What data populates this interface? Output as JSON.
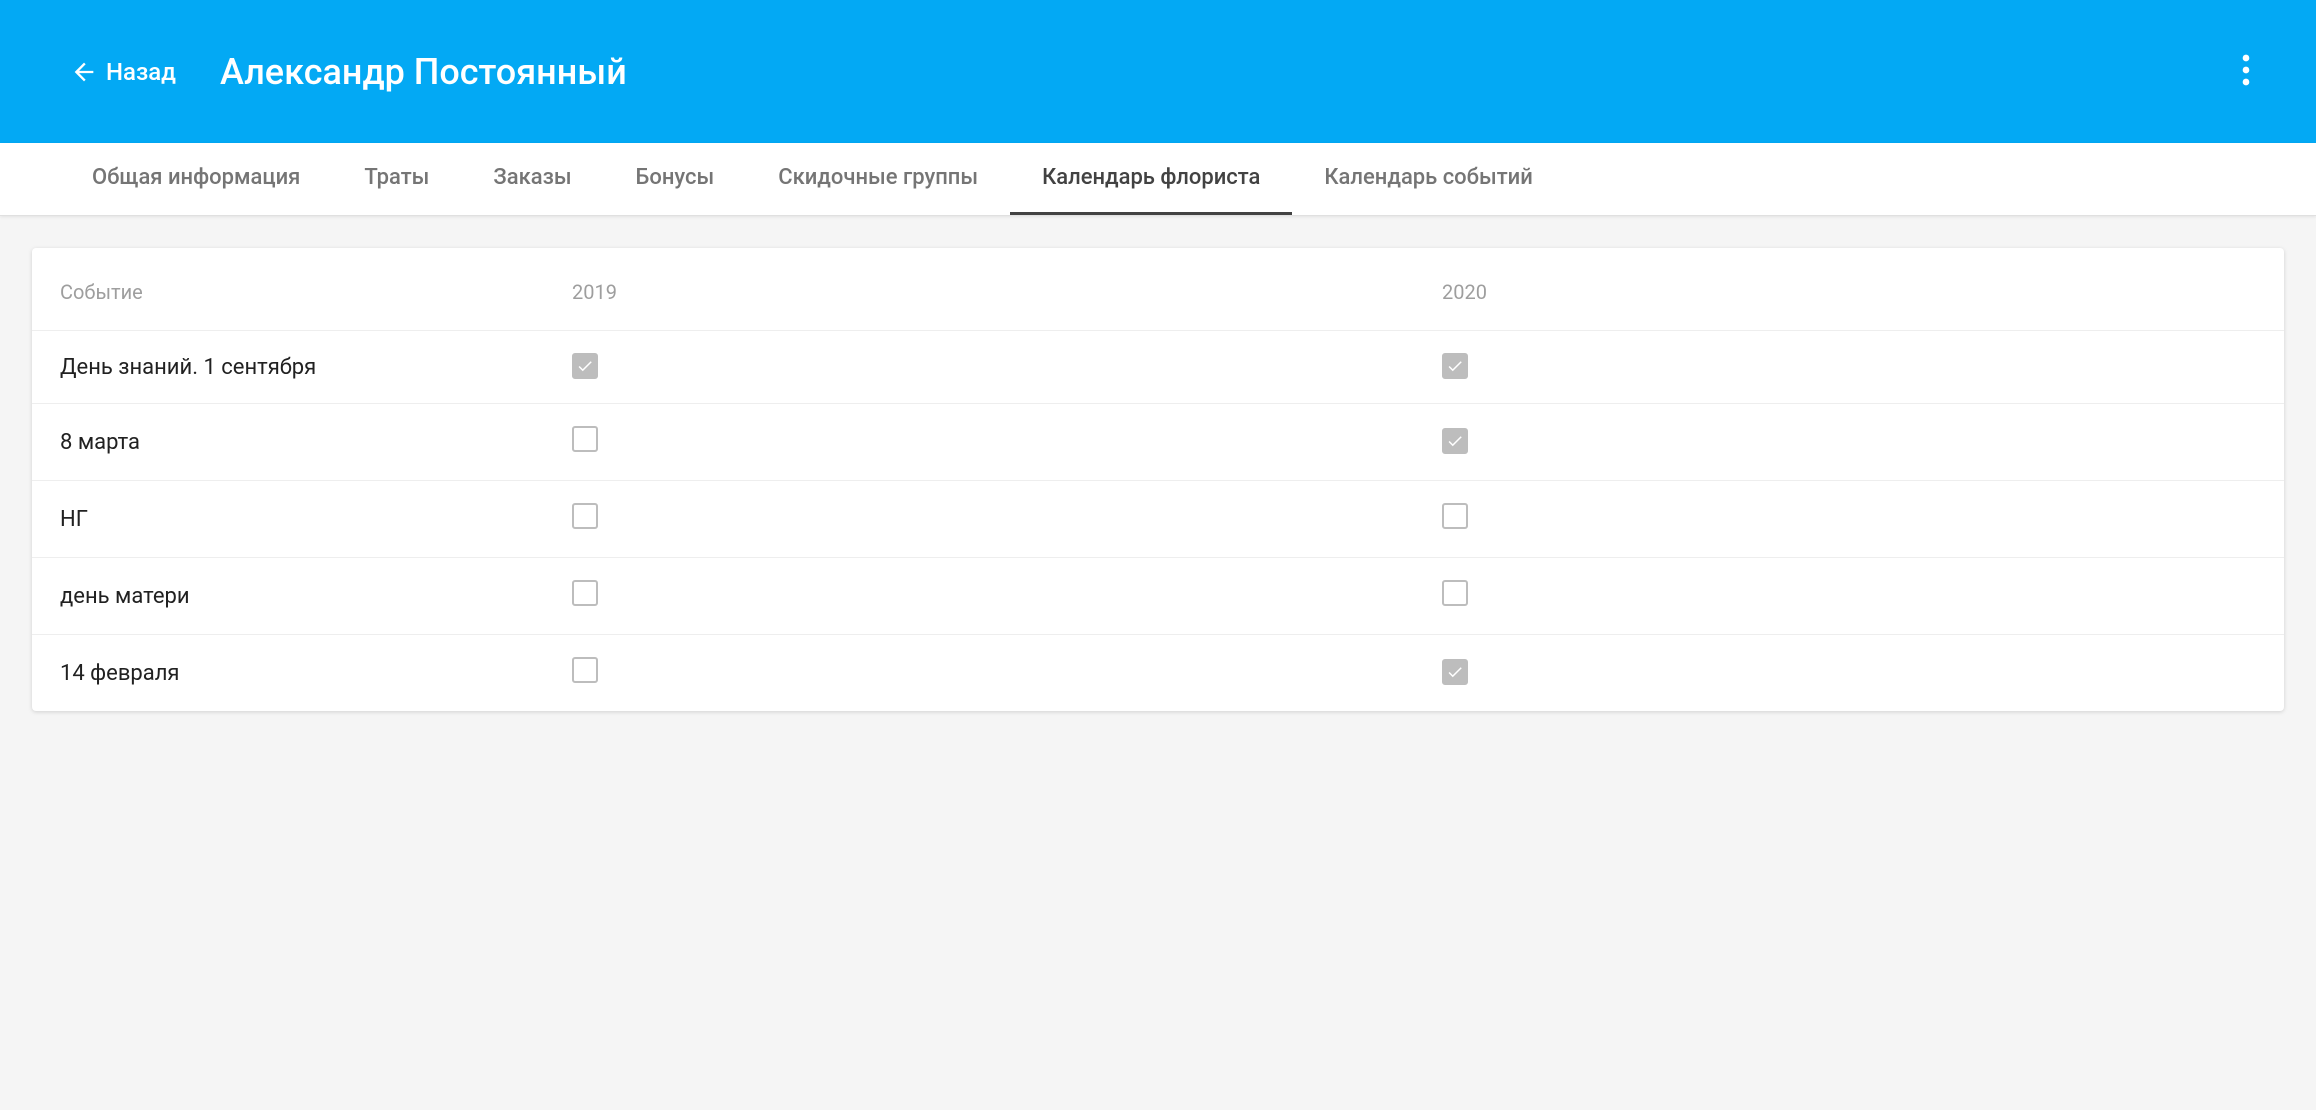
{
  "header": {
    "back_label": "Назад",
    "title": "Александр Постоянный"
  },
  "tabs": [
    {
      "label": "Общая информация",
      "active": false
    },
    {
      "label": "Траты",
      "active": false
    },
    {
      "label": "Заказы",
      "active": false
    },
    {
      "label": "Бонусы",
      "active": false
    },
    {
      "label": "Скидочные группы",
      "active": false
    },
    {
      "label": "Календарь флориста",
      "active": true
    },
    {
      "label": "Календарь событий",
      "active": false
    }
  ],
  "table": {
    "columns": [
      "Событие",
      "2019",
      "2020"
    ],
    "rows": [
      {
        "event": "День знаний. 1 сентября",
        "y2019": true,
        "y2020": true
      },
      {
        "event": "8 марта",
        "y2019": false,
        "y2020": true
      },
      {
        "event": "НГ",
        "y2019": false,
        "y2020": false
      },
      {
        "event": "день матери",
        "y2019": false,
        "y2020": false
      },
      {
        "event": "14 февраля",
        "y2019": false,
        "y2020": true
      }
    ]
  }
}
